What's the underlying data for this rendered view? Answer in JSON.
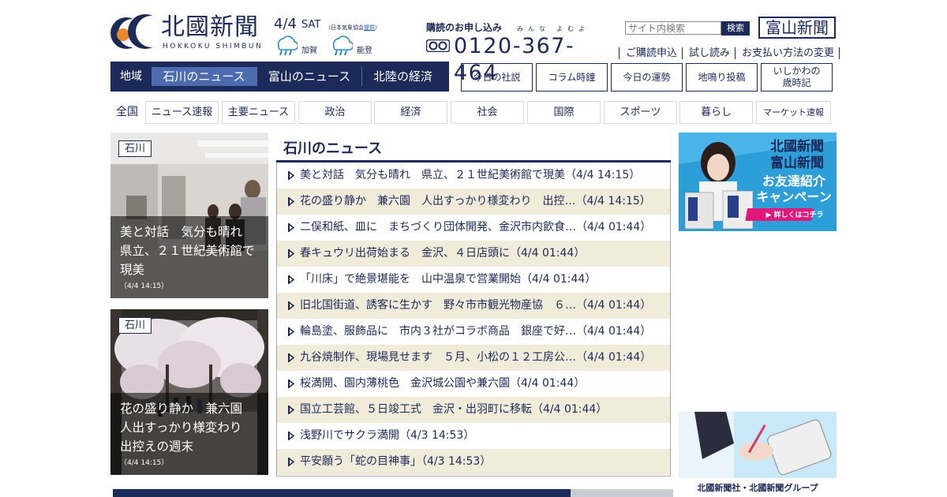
{
  "header": {
    "logo_name": "北國新聞",
    "logo_romaji": "HOKKOKU SHIMBUN",
    "date": "4/4",
    "weekday": "SAT",
    "weather_source_prefix": "（日本気象協会",
    "weather_source_link": "提供",
    "weather_source_suffix": "）",
    "weather": [
      {
        "region": "加賀",
        "icon": "rain-icon"
      },
      {
        "region": "能登",
        "icon": "rain-icon"
      }
    ],
    "subscription_label": "購読のお申し込み",
    "ruby_minna": "みんな",
    "ruby_yomu": "よむよ",
    "phone": "0120-367-464",
    "search_placeholder": "サイト内検索",
    "search_button": "検索",
    "toyama_logo": "富山新聞",
    "links": [
      "ご購読申込",
      "試し読み",
      "お支払い方法の変更"
    ]
  },
  "region_nav": {
    "label": "地域",
    "tabs": [
      "石川のニュース",
      "富山のニュース",
      "北陸の経済"
    ],
    "active": "石川のニュース"
  },
  "top_buttons": [
    "今日の社説",
    "コラム時鐘",
    "今日の運勢",
    "地鳴り投稿",
    "いしかわの\n歳時記"
  ],
  "category_nav": {
    "all": "全国",
    "items": [
      "ニュース速報",
      "主要ニュース",
      "政治",
      "経済",
      "社会",
      "国際",
      "スポーツ",
      "暮らし",
      "マーケット速報"
    ]
  },
  "featured": [
    {
      "tag": "石川",
      "title": "美と対話　気分も晴れ　県立、２１世紀美術館で現美",
      "time": "（4/4 14:15）"
    },
    {
      "tag": "石川",
      "title": "花の盛り静か　兼六園　人出すっかり様変わり　出控えの週末",
      "time": "（4/4 14:15）"
    }
  ],
  "news": {
    "heading": "石川のニュース",
    "items": [
      "美と対話　気分も晴れ　県立、２１世紀美術館で現美（4/4 14:15）",
      "花の盛り静か　兼六園　人出すっかり様変わり　出控…（4/4 14:15）",
      "二俣和紙、皿に　まちづくり団体開発、金沢市内飲食…（4/4 01:44）",
      "春キュウリ出荷始まる　金沢、４日店頭に（4/4 01:44）",
      "「川床」で絶景堪能を　山中温泉で営業開始（4/4 01:44）",
      "旧北国街道、誘客に生かす　野々市市観光物産協　６…（4/4 01:44）",
      "輪島塗、服飾品に　市内３社がコラボ商品　銀座で好…（4/4 01:44）",
      "九谷焼制作、現場見せます　５月、小松の１２工房公…（4/4 01:44）",
      "桜満開、園内薄桃色　金沢城公園や兼六園（4/4 01:44）",
      "国立工芸館、５日竣工式　金沢・出羽町に移転（4/4 01:44）",
      "浅野川でサクラ満開（4/3 14:53）",
      "平安願う「蛇の目神事」（4/3 14:53）"
    ]
  },
  "banners": {
    "campaign_line1": "北國新聞",
    "campaign_line2": "富山新聞",
    "campaign_line3": "お友達紹介",
    "campaign_line4": "キャンペーン",
    "campaign_cta": "▶ 詳しくはコチラ",
    "group_label": "北國新聞社・北國新聞グループ"
  },
  "colors": {
    "navy": "#1c2a5a",
    "active_tab": "#4d6cb0",
    "row_alt": "#f0ecd9",
    "banner_blue": "#2d9fd8"
  }
}
